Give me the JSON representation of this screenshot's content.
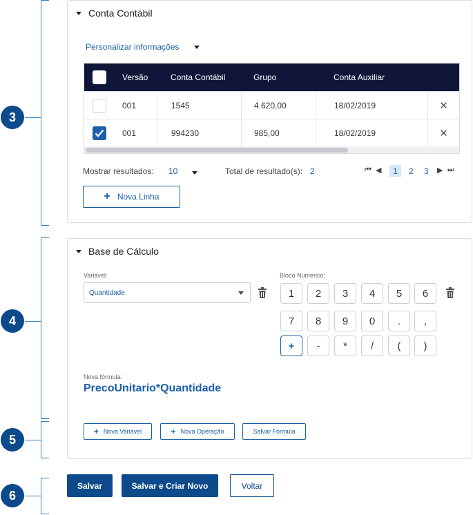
{
  "annotations": [
    "3",
    "4",
    "5",
    "6"
  ],
  "conta_contabil": {
    "title": "Conta Contábil",
    "personalizar": "Personalizar informações",
    "columns": [
      "Versão",
      "Conta Contábil",
      "Grupo",
      "Conta Auxiliar"
    ],
    "rows": [
      {
        "versao": "001",
        "conta": "1545",
        "grupo": "4.620,00",
        "aux": "18/02/2019",
        "checked": false
      },
      {
        "versao": "001",
        "conta": "994230",
        "grupo": "985,00",
        "aux": "18/02/2019",
        "checked": true
      }
    ],
    "mostrar_label": "Mostrar resultados:",
    "mostrar_value": "10",
    "total_label": "Total de resultado(s):",
    "total_value": "2",
    "pages": [
      "1",
      "2",
      "3"
    ],
    "current_page": "1",
    "nova_linha": "Nova Linha"
  },
  "base_calculo": {
    "title": "Base de Cálculo",
    "variavel_label": "Variável:",
    "variavel_value": "Quantidade",
    "bloco_label": "Bloco Numérico:",
    "keys": [
      [
        "1",
        "2",
        "3",
        "4",
        "5",
        "6"
      ],
      [
        "7",
        "8",
        "9",
        "0",
        ".",
        ","
      ],
      [
        "+",
        "-",
        "*",
        "/",
        "(",
        ")"
      ]
    ],
    "active_key": "+",
    "nova_formula_label": "Nova fórmula:",
    "formula": "PrecoUnitario*Quantidade",
    "nova_variavel": "Nova Variável",
    "nova_operacao": "Nova Operação",
    "salvar_formula": "Salvar Fórmula"
  },
  "footer": {
    "salvar": "Salvar",
    "salvar_criar": "Salvar e Criar Novo",
    "voltar": "Voltar"
  },
  "colors": {
    "primary": "#0d4a8c",
    "link": "#1a5fa8",
    "header": "#10163a"
  }
}
